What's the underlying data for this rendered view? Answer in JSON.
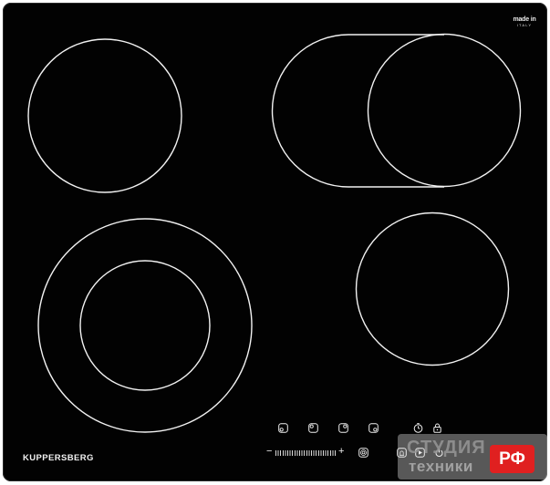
{
  "brand": "KUPPERSBERG",
  "made_in": {
    "logo": "made in",
    "country": "ITALY"
  },
  "colors": {
    "surface": "#020202",
    "marking": "#f2f2f2",
    "watermark_badge": "#e02020"
  },
  "cooking_zones": [
    {
      "name": "rear-left",
      "type": "single"
    },
    {
      "name": "rear-right",
      "type": "oval-extended"
    },
    {
      "name": "front-left",
      "type": "dual-ring"
    },
    {
      "name": "front-right",
      "type": "single"
    }
  ],
  "controls": {
    "zone_selectors": [
      {
        "icon": "zone-front-left-icon"
      },
      {
        "icon": "zone-rear-left-icon"
      },
      {
        "icon": "zone-rear-right-icon"
      },
      {
        "icon": "zone-front-right-icon"
      }
    ],
    "timer_icon": "timer-icon",
    "lock_icon": "lock-icon",
    "power_slider": {
      "minus": "−",
      "plus": "+"
    },
    "dual_zone_icon": "dual-zone-icon",
    "keep_warm_icon": "keep-warm-icon",
    "pause_icon": "pause-icon",
    "power_icon": "power-icon"
  },
  "watermark": {
    "line1": "СТУДИЯ",
    "line2": "техники",
    "badge": "РФ"
  }
}
